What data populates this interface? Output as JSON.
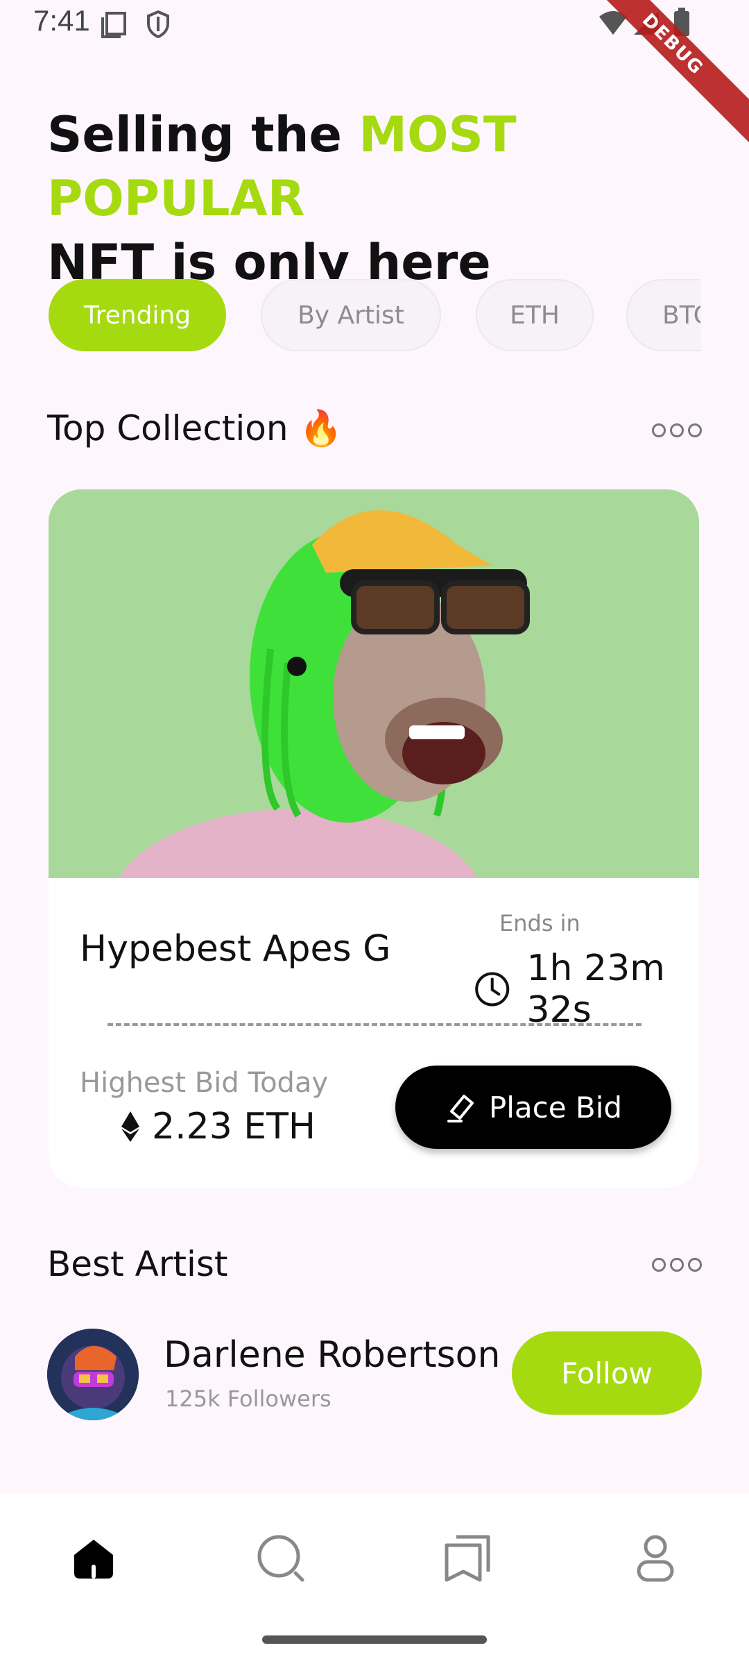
{
  "status_bar": {
    "time": "7:41"
  },
  "debug_banner": "DEBUG",
  "headline": {
    "part1": "Selling the ",
    "accent": "MOST POPULAR",
    "part2": "NFT is only here"
  },
  "chips": [
    {
      "label": "Trending",
      "active": true
    },
    {
      "label": "By Artist",
      "active": false
    },
    {
      "label": "ETH",
      "active": false
    },
    {
      "label": "BTC",
      "active": false
    }
  ],
  "top_collection": {
    "title": "Top Collection 🔥",
    "item": {
      "name": "Hypebest Apes G",
      "ends_label": "Ends in",
      "timer": "1h 23m 32s",
      "bid_label": "Highest Bid Today",
      "bid_value": "2.23 ETH",
      "action": "Place Bid"
    }
  },
  "best_artist": {
    "title": "Best Artist",
    "artist": {
      "name": "Darlene Robertson",
      "followers": "125k Followers",
      "action": "Follow"
    }
  },
  "colors": {
    "accent": "#A6DA10",
    "background": "#FDF6FD",
    "card_bg": "#A9D89B"
  },
  "nav": [
    {
      "icon": "home-icon",
      "active": true
    },
    {
      "icon": "search-icon",
      "active": false
    },
    {
      "icon": "collections-icon",
      "active": false
    },
    {
      "icon": "profile-icon",
      "active": false
    }
  ]
}
